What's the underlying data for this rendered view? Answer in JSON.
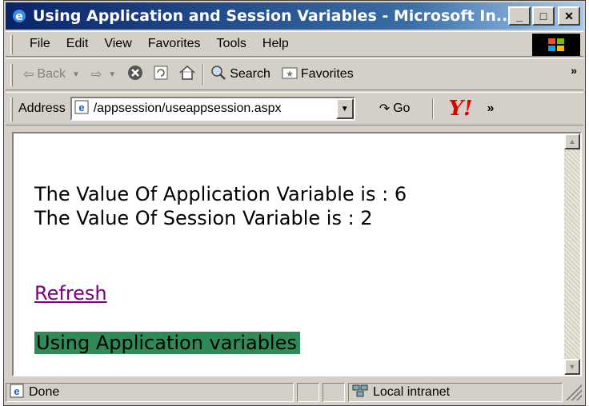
{
  "window": {
    "title": "Using Application and Session Variables - Microsoft In...",
    "title_buttons": {
      "minimize": "_",
      "maximize": "□",
      "close": "✕"
    }
  },
  "menu": [
    "File",
    "Edit",
    "View",
    "Favorites",
    "Tools",
    "Help"
  ],
  "toolbar": {
    "back_label": "Back",
    "search_label": "Search",
    "favorites_label": "Favorites",
    "overflow": "»"
  },
  "address": {
    "label": "Address",
    "value": "/appsession/useappsession.aspx",
    "go_label": "Go",
    "overflow": "»"
  },
  "page": {
    "application_line": "The Value Of Application Variable is : 6",
    "session_line": "The Value Of Session Variable is : 2",
    "refresh_link": "Refresh",
    "highlight_text": "Using Application variables",
    "highlight_color": "#2e8b57",
    "link_color": "#800080"
  },
  "status": {
    "text": "Done",
    "zone": "Local intranet"
  },
  "colors": {
    "title_bar": "#0a246a",
    "chrome": "#d4d0c8"
  }
}
